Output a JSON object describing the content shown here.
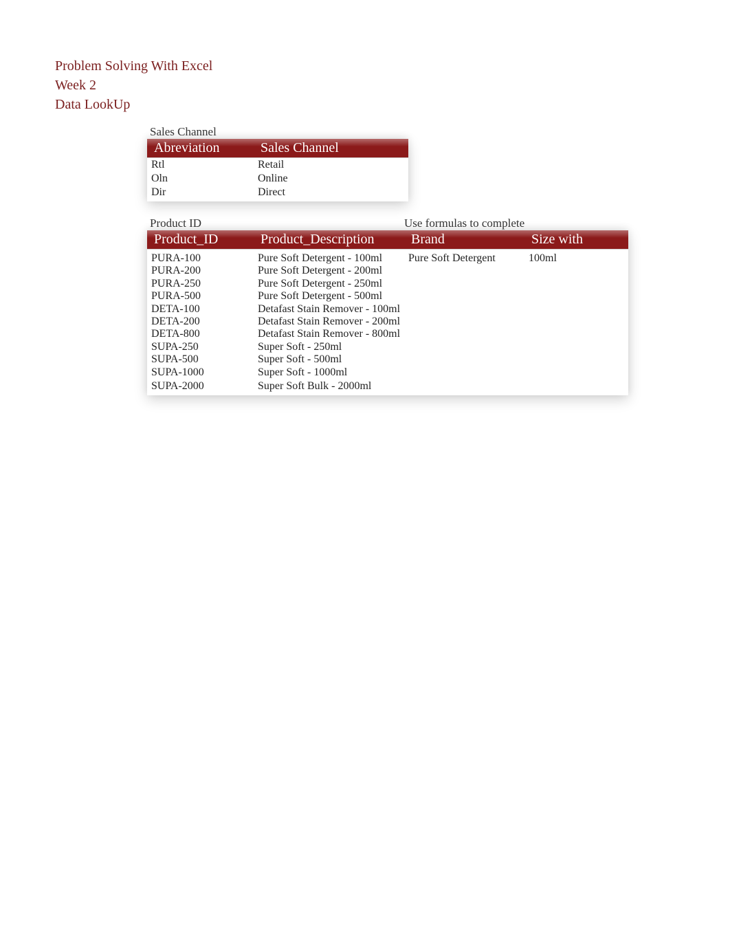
{
  "titles": {
    "line1": "Problem Solving With Excel",
    "line2": "Week 2",
    "line3": "Data LookUp"
  },
  "salesChannel": {
    "sectionLabel": "Sales Channel",
    "headers": {
      "col1": "Abreviation",
      "col2": "Sales Channel"
    },
    "rows": [
      {
        "abbr": "Rtl",
        "channel": "Retail"
      },
      {
        "abbr": "Oln",
        "channel": "Online"
      },
      {
        "abbr": "Dir",
        "channel": "Direct"
      }
    ]
  },
  "products": {
    "sectionLabelLeft": "Product ID",
    "sectionLabelRight": "Use formulas to complete",
    "headers": {
      "col1": "Product_ID",
      "col2": "Product_Description",
      "col3": "Brand",
      "col4": "Size with"
    },
    "rows": [
      {
        "id": "PURA-100",
        "desc": "Pure Soft Detergent - 100ml",
        "brand": "Pure Soft Detergent",
        "size": "100ml"
      },
      {
        "id": "PURA-200",
        "desc": "Pure Soft Detergent - 200ml",
        "brand": "",
        "size": ""
      },
      {
        "id": "PURA-250",
        "desc": "Pure Soft Detergent - 250ml",
        "brand": "",
        "size": ""
      },
      {
        "id": "PURA-500",
        "desc": "Pure Soft Detergent - 500ml",
        "brand": "",
        "size": ""
      },
      {
        "id": "DETA-100",
        "desc": "Detafast Stain Remover - 100ml",
        "brand": "",
        "size": ""
      },
      {
        "id": "DETA-200",
        "desc": "Detafast Stain Remover - 200ml",
        "brand": "",
        "size": ""
      },
      {
        "id": "DETA-800",
        "desc": "Detafast Stain Remover - 800ml",
        "brand": "",
        "size": ""
      },
      {
        "id": "SUPA-250",
        "desc": "Super Soft - 250ml",
        "brand": "",
        "size": ""
      },
      {
        "id": "SUPA-500",
        "desc": "Super Soft - 500ml",
        "brand": "",
        "size": ""
      },
      {
        "id": "SUPA-1000",
        "desc": "Super Soft - 1000ml",
        "brand": "",
        "size": ""
      },
      {
        "id": "SUPA-2000",
        "desc": "Super Soft Bulk - 2000ml",
        "brand": "",
        "size": ""
      }
    ]
  }
}
